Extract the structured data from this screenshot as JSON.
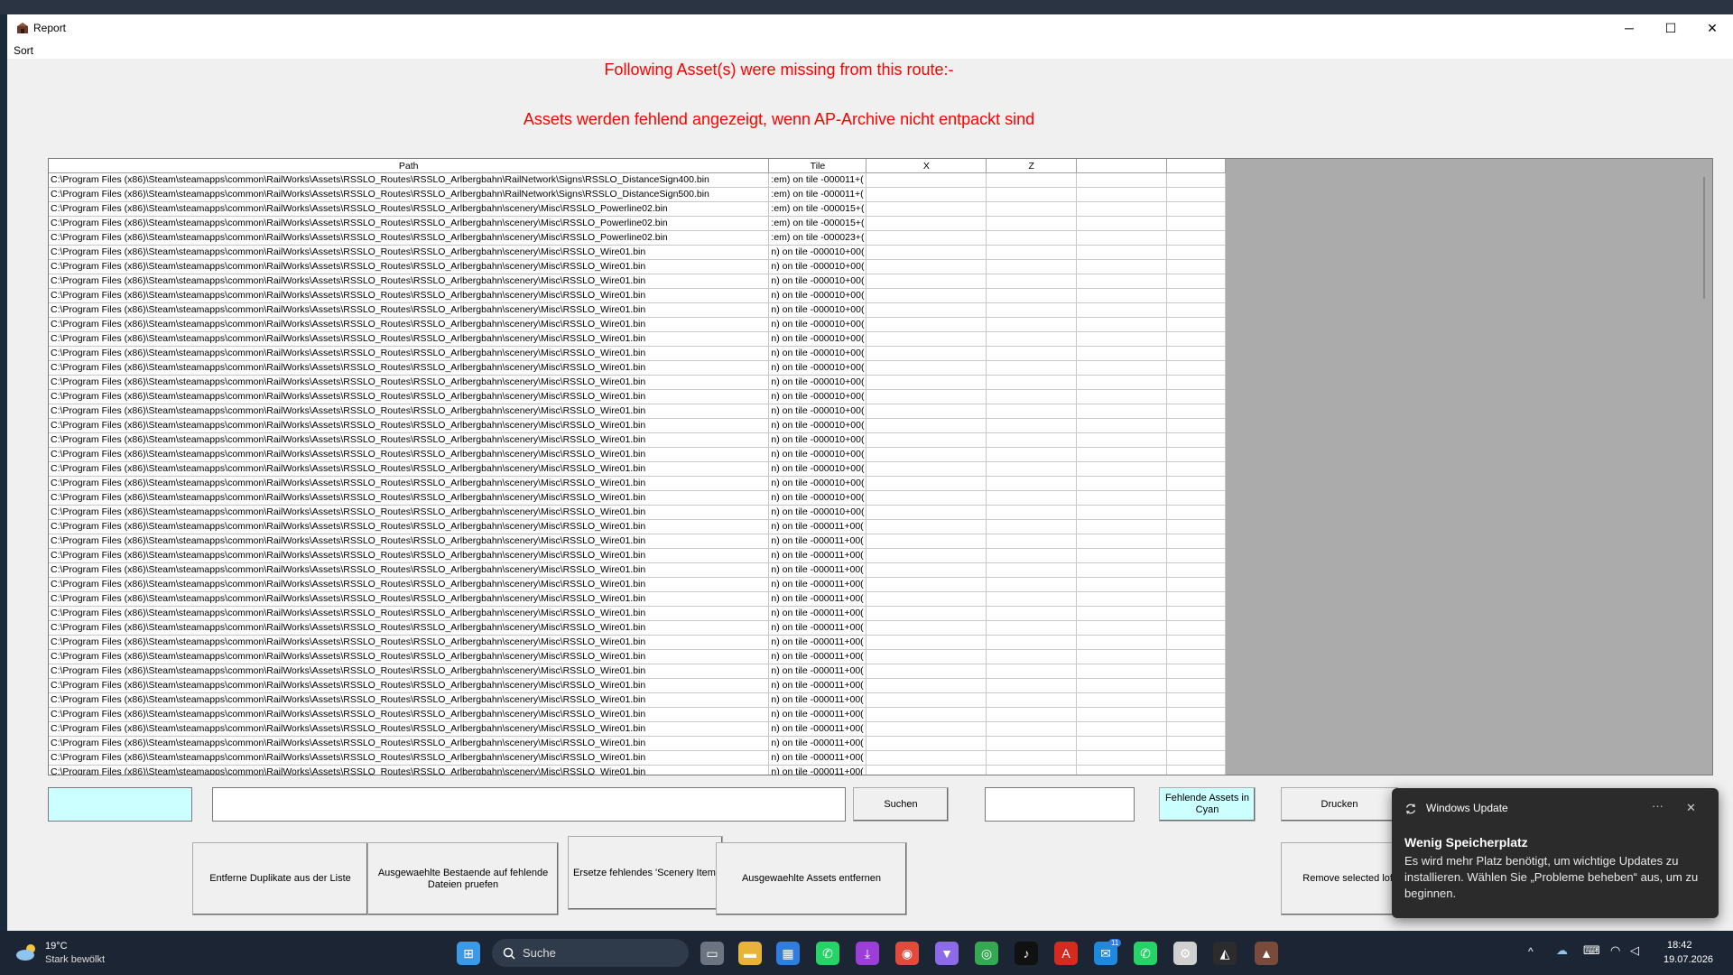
{
  "window": {
    "title": "Report",
    "minimize_glyph": "─",
    "maximize_glyph": "☐",
    "close_glyph": "✕"
  },
  "menu": {
    "sort": "Sort"
  },
  "messages": {
    "line1": "Following Asset(s) were missing from this route:-",
    "line2": "Assets werden fehlend angezeigt, wenn AP-Archive nicht entpackt sind"
  },
  "table": {
    "headers": [
      "Path",
      "Tile",
      "X",
      "Z",
      "",
      ""
    ],
    "rows": [
      [
        "C:\\Program Files (x86)\\Steam\\steamapps\\common\\RailWorks\\Assets\\RSSLO_Routes\\RSSLO_Arlbergbahn\\RailNetwork\\Signs\\RSSLO_DistanceSign400.bin",
        ":em) on tile -000011+(",
        "",
        "",
        "",
        ""
      ],
      [
        "C:\\Program Files (x86)\\Steam\\steamapps\\common\\RailWorks\\Assets\\RSSLO_Routes\\RSSLO_Arlbergbahn\\RailNetwork\\Signs\\RSSLO_DistanceSign500.bin",
        ":em) on tile -000011+(",
        "",
        "",
        "",
        ""
      ],
      [
        "C:\\Program Files (x86)\\Steam\\steamapps\\common\\RailWorks\\Assets\\RSSLO_Routes\\RSSLO_Arlbergbahn\\scenery\\Misc\\RSSLO_Powerline02.bin",
        ":em) on tile -000015+(",
        "",
        "",
        "",
        ""
      ],
      [
        "C:\\Program Files (x86)\\Steam\\steamapps\\common\\RailWorks\\Assets\\RSSLO_Routes\\RSSLO_Arlbergbahn\\scenery\\Misc\\RSSLO_Powerline02.bin",
        ":em) on tile -000015+(",
        "",
        "",
        "",
        ""
      ],
      [
        "C:\\Program Files (x86)\\Steam\\steamapps\\common\\RailWorks\\Assets\\RSSLO_Routes\\RSSLO_Arlbergbahn\\scenery\\Misc\\RSSLO_Powerline02.bin",
        ":em) on tile -000023+(",
        "",
        "",
        "",
        ""
      ],
      [
        "C:\\Program Files (x86)\\Steam\\steamapps\\common\\RailWorks\\Assets\\RSSLO_Routes\\RSSLO_Arlbergbahn\\scenery\\Misc\\RSSLO_Wire01.bin",
        "n) on tile -000010+00(",
        "",
        "",
        "",
        ""
      ],
      [
        "C:\\Program Files (x86)\\Steam\\steamapps\\common\\RailWorks\\Assets\\RSSLO_Routes\\RSSLO_Arlbergbahn\\scenery\\Misc\\RSSLO_Wire01.bin",
        "n) on tile -000010+00(",
        "",
        "",
        "",
        ""
      ],
      [
        "C:\\Program Files (x86)\\Steam\\steamapps\\common\\RailWorks\\Assets\\RSSLO_Routes\\RSSLO_Arlbergbahn\\scenery\\Misc\\RSSLO_Wire01.bin",
        "n) on tile -000010+00(",
        "",
        "",
        "",
        ""
      ],
      [
        "C:\\Program Files (x86)\\Steam\\steamapps\\common\\RailWorks\\Assets\\RSSLO_Routes\\RSSLO_Arlbergbahn\\scenery\\Misc\\RSSLO_Wire01.bin",
        "n) on tile -000010+00(",
        "",
        "",
        "",
        ""
      ],
      [
        "C:\\Program Files (x86)\\Steam\\steamapps\\common\\RailWorks\\Assets\\RSSLO_Routes\\RSSLO_Arlbergbahn\\scenery\\Misc\\RSSLO_Wire01.bin",
        "n) on tile -000010+00(",
        "",
        "",
        "",
        ""
      ],
      [
        "C:\\Program Files (x86)\\Steam\\steamapps\\common\\RailWorks\\Assets\\RSSLO_Routes\\RSSLO_Arlbergbahn\\scenery\\Misc\\RSSLO_Wire01.bin",
        "n) on tile -000010+00(",
        "",
        "",
        "",
        ""
      ],
      [
        "C:\\Program Files (x86)\\Steam\\steamapps\\common\\RailWorks\\Assets\\RSSLO_Routes\\RSSLO_Arlbergbahn\\scenery\\Misc\\RSSLO_Wire01.bin",
        "n) on tile -000010+00(",
        "",
        "",
        "",
        ""
      ],
      [
        "C:\\Program Files (x86)\\Steam\\steamapps\\common\\RailWorks\\Assets\\RSSLO_Routes\\RSSLO_Arlbergbahn\\scenery\\Misc\\RSSLO_Wire01.bin",
        "n) on tile -000010+00(",
        "",
        "",
        "",
        ""
      ],
      [
        "C:\\Program Files (x86)\\Steam\\steamapps\\common\\RailWorks\\Assets\\RSSLO_Routes\\RSSLO_Arlbergbahn\\scenery\\Misc\\RSSLO_Wire01.bin",
        "n) on tile -000010+00(",
        "",
        "",
        "",
        ""
      ],
      [
        "C:\\Program Files (x86)\\Steam\\steamapps\\common\\RailWorks\\Assets\\RSSLO_Routes\\RSSLO_Arlbergbahn\\scenery\\Misc\\RSSLO_Wire01.bin",
        "n) on tile -000010+00(",
        "",
        "",
        "",
        ""
      ],
      [
        "C:\\Program Files (x86)\\Steam\\steamapps\\common\\RailWorks\\Assets\\RSSLO_Routes\\RSSLO_Arlbergbahn\\scenery\\Misc\\RSSLO_Wire01.bin",
        "n) on tile -000010+00(",
        "",
        "",
        "",
        ""
      ],
      [
        "C:\\Program Files (x86)\\Steam\\steamapps\\common\\RailWorks\\Assets\\RSSLO_Routes\\RSSLO_Arlbergbahn\\scenery\\Misc\\RSSLO_Wire01.bin",
        "n) on tile -000010+00(",
        "",
        "",
        "",
        ""
      ],
      [
        "C:\\Program Files (x86)\\Steam\\steamapps\\common\\RailWorks\\Assets\\RSSLO_Routes\\RSSLO_Arlbergbahn\\scenery\\Misc\\RSSLO_Wire01.bin",
        "n) on tile -000010+00(",
        "",
        "",
        "",
        ""
      ],
      [
        "C:\\Program Files (x86)\\Steam\\steamapps\\common\\RailWorks\\Assets\\RSSLO_Routes\\RSSLO_Arlbergbahn\\scenery\\Misc\\RSSLO_Wire01.bin",
        "n) on tile -000010+00(",
        "",
        "",
        "",
        ""
      ],
      [
        "C:\\Program Files (x86)\\Steam\\steamapps\\common\\RailWorks\\Assets\\RSSLO_Routes\\RSSLO_Arlbergbahn\\scenery\\Misc\\RSSLO_Wire01.bin",
        "n) on tile -000010+00(",
        "",
        "",
        "",
        ""
      ],
      [
        "C:\\Program Files (x86)\\Steam\\steamapps\\common\\RailWorks\\Assets\\RSSLO_Routes\\RSSLO_Arlbergbahn\\scenery\\Misc\\RSSLO_Wire01.bin",
        "n) on tile -000010+00(",
        "",
        "",
        "",
        ""
      ],
      [
        "C:\\Program Files (x86)\\Steam\\steamapps\\common\\RailWorks\\Assets\\RSSLO_Routes\\RSSLO_Arlbergbahn\\scenery\\Misc\\RSSLO_Wire01.bin",
        "n) on tile -000010+00(",
        "",
        "",
        "",
        ""
      ],
      [
        "C:\\Program Files (x86)\\Steam\\steamapps\\common\\RailWorks\\Assets\\RSSLO_Routes\\RSSLO_Arlbergbahn\\scenery\\Misc\\RSSLO_Wire01.bin",
        "n) on tile -000010+00(",
        "",
        "",
        "",
        ""
      ],
      [
        "C:\\Program Files (x86)\\Steam\\steamapps\\common\\RailWorks\\Assets\\RSSLO_Routes\\RSSLO_Arlbergbahn\\scenery\\Misc\\RSSLO_Wire01.bin",
        "n) on tile -000010+00(",
        "",
        "",
        "",
        ""
      ],
      [
        "C:\\Program Files (x86)\\Steam\\steamapps\\common\\RailWorks\\Assets\\RSSLO_Routes\\RSSLO_Arlbergbahn\\scenery\\Misc\\RSSLO_Wire01.bin",
        "n) on tile -000011+00(",
        "",
        "",
        "",
        ""
      ],
      [
        "C:\\Program Files (x86)\\Steam\\steamapps\\common\\RailWorks\\Assets\\RSSLO_Routes\\RSSLO_Arlbergbahn\\scenery\\Misc\\RSSLO_Wire01.bin",
        "n) on tile -000011+00(",
        "",
        "",
        "",
        ""
      ],
      [
        "C:\\Program Files (x86)\\Steam\\steamapps\\common\\RailWorks\\Assets\\RSSLO_Routes\\RSSLO_Arlbergbahn\\scenery\\Misc\\RSSLO_Wire01.bin",
        "n) on tile -000011+00(",
        "",
        "",
        "",
        ""
      ],
      [
        "C:\\Program Files (x86)\\Steam\\steamapps\\common\\RailWorks\\Assets\\RSSLO_Routes\\RSSLO_Arlbergbahn\\scenery\\Misc\\RSSLO_Wire01.bin",
        "n) on tile -000011+00(",
        "",
        "",
        "",
        ""
      ],
      [
        "C:\\Program Files (x86)\\Steam\\steamapps\\common\\RailWorks\\Assets\\RSSLO_Routes\\RSSLO_Arlbergbahn\\scenery\\Misc\\RSSLO_Wire01.bin",
        "n) on tile -000011+00(",
        "",
        "",
        "",
        ""
      ],
      [
        "C:\\Program Files (x86)\\Steam\\steamapps\\common\\RailWorks\\Assets\\RSSLO_Routes\\RSSLO_Arlbergbahn\\scenery\\Misc\\RSSLO_Wire01.bin",
        "n) on tile -000011+00(",
        "",
        "",
        "",
        ""
      ],
      [
        "C:\\Program Files (x86)\\Steam\\steamapps\\common\\RailWorks\\Assets\\RSSLO_Routes\\RSSLO_Arlbergbahn\\scenery\\Misc\\RSSLO_Wire01.bin",
        "n) on tile -000011+00(",
        "",
        "",
        "",
        ""
      ],
      [
        "C:\\Program Files (x86)\\Steam\\steamapps\\common\\RailWorks\\Assets\\RSSLO_Routes\\RSSLO_Arlbergbahn\\scenery\\Misc\\RSSLO_Wire01.bin",
        "n) on tile -000011+00(",
        "",
        "",
        "",
        ""
      ],
      [
        "C:\\Program Files (x86)\\Steam\\steamapps\\common\\RailWorks\\Assets\\RSSLO_Routes\\RSSLO_Arlbergbahn\\scenery\\Misc\\RSSLO_Wire01.bin",
        "n) on tile -000011+00(",
        "",
        "",
        "",
        ""
      ],
      [
        "C:\\Program Files (x86)\\Steam\\steamapps\\common\\RailWorks\\Assets\\RSSLO_Routes\\RSSLO_Arlbergbahn\\scenery\\Misc\\RSSLO_Wire01.bin",
        "n) on tile -000011+00(",
        "",
        "",
        "",
        ""
      ],
      [
        "C:\\Program Files (x86)\\Steam\\steamapps\\common\\RailWorks\\Assets\\RSSLO_Routes\\RSSLO_Arlbergbahn\\scenery\\Misc\\RSSLO_Wire01.bin",
        "n) on tile -000011+00(",
        "",
        "",
        "",
        ""
      ],
      [
        "C:\\Program Files (x86)\\Steam\\steamapps\\common\\RailWorks\\Assets\\RSSLO_Routes\\RSSLO_Arlbergbahn\\scenery\\Misc\\RSSLO_Wire01.bin",
        "n) on tile -000011+00(",
        "",
        "",
        "",
        ""
      ],
      [
        "C:\\Program Files (x86)\\Steam\\steamapps\\common\\RailWorks\\Assets\\RSSLO_Routes\\RSSLO_Arlbergbahn\\scenery\\Misc\\RSSLO_Wire01.bin",
        "n) on tile -000011+00(",
        "",
        "",
        "",
        ""
      ],
      [
        "C:\\Program Files (x86)\\Steam\\steamapps\\common\\RailWorks\\Assets\\RSSLO_Routes\\RSSLO_Arlbergbahn\\scenery\\Misc\\RSSLO_Wire01.bin",
        "n) on tile -000011+00(",
        "",
        "",
        "",
        ""
      ],
      [
        "C:\\Program Files (x86)\\Steam\\steamapps\\common\\RailWorks\\Assets\\RSSLO_Routes\\RSSLO_Arlbergbahn\\scenery\\Misc\\RSSLO_Wire01.bin",
        "n) on tile -000011+00(",
        "",
        "",
        "",
        ""
      ],
      [
        "C:\\Program Files (x86)\\Steam\\steamapps\\common\\RailWorks\\Assets\\RSSLO_Routes\\RSSLO_Arlbergbahn\\scenery\\Misc\\RSSLO_Wire01.bin",
        "n) on tile -000011+00(",
        "",
        "",
        "",
        ""
      ],
      [
        "C:\\Program Files (x86)\\Steam\\steamapps\\common\\RailWorks\\Assets\\RSSLO_Routes\\RSSLO_Arlbergbahn\\scenery\\Misc\\RSSLO_Wire01.bin",
        "n) on tile -000011+00(",
        "",
        "",
        "",
        ""
      ],
      [
        "C:\\Program Files (x86)\\Steam\\steamapps\\common\\RailWorks\\Assets\\RSSLO_Routes\\RSSLO_Arlbergbahn\\scenery\\Misc\\RSSLO_Wire01.bin",
        "n) on tile -000011+00(",
        "",
        "",
        "",
        ""
      ],
      [
        "C:\\Program Files (x86)\\Steam\\steamapps\\common\\RailWorks\\Assets\\RSSLO_Routes\\RSSLO_Arlbergbahn\\scenery\\Misc\\RSSLO_Wire01.bin",
        "n) on tile -000011+00(",
        "",
        "",
        "",
        ""
      ]
    ]
  },
  "controls": {
    "search_value": "",
    "search_button": "Suchen",
    "right_input_value": "",
    "cyan_button": "Fehlende Assets in Cyan",
    "print_button": "Drucken",
    "remove_duplicates": "Entferne Duplikate aus der Liste",
    "check_selected": "Ausgewaehlte Bestaende auf fehlende Dateien pruefen",
    "replace_scenery": "Ersetze fehlendes 'Scenery Item'",
    "remove_selected_assets": "Ausgewaehlte Assets entfernen",
    "remove_selected_lofts": "Remove selected loft"
  },
  "toast": {
    "app": "Windows Update",
    "title": "Wenig Speicherplatz",
    "body": "Es wird mehr Platz benötigt, um wichtige Updates zu installieren. Wählen Sie „Probleme beheben“ aus, um zu beginnen.",
    "more_glyph": "···",
    "close_glyph": "✕"
  },
  "taskbar": {
    "weather_temp": "19°C",
    "weather_desc": "Stark bewölkt",
    "search_label": "Suche",
    "time": "18:42",
    "date": "19.07.2026",
    "badge_count": "11",
    "icons": [
      {
        "name": "windows-start-icon",
        "color": "#3b9ae8",
        "glyph": "⊞"
      },
      {
        "name": "task-view-icon",
        "color": "#6b7480",
        "glyph": "▭"
      },
      {
        "name": "file-explorer-icon",
        "color": "#e8b339",
        "glyph": "▬"
      },
      {
        "name": "microsoft-store-icon",
        "color": "#2f7de0",
        "glyph": "▦"
      },
      {
        "name": "whatsapp-icon",
        "color": "#25d366",
        "glyph": "✆"
      },
      {
        "name": "download-app-icon",
        "color": "#9b3fd8",
        "glyph": "⤓"
      },
      {
        "name": "chrome-icon",
        "color": "#e24a3b",
        "glyph": "◉"
      },
      {
        "name": "vpn-icon",
        "color": "#8c6ae8",
        "glyph": "▼"
      },
      {
        "name": "maps-icon",
        "color": "#34a853",
        "glyph": "◎"
      },
      {
        "name": "tiktok-icon",
        "color": "#111111",
        "glyph": "♪"
      },
      {
        "name": "acrobat-icon",
        "color": "#d42b1e",
        "glyph": "A"
      },
      {
        "name": "messaging-app-icon",
        "color": "#1d8ae0",
        "glyph": "✉"
      },
      {
        "name": "whatsapp-business-icon",
        "color": "#25d366",
        "glyph": "✆"
      },
      {
        "name": "tool-app-icon",
        "color": "#d0d0d0",
        "glyph": "⚙"
      },
      {
        "name": "arc-app-icon",
        "color": "#2c2c2c",
        "glyph": "◭"
      },
      {
        "name": "railworks-app-icon",
        "color": "#7a4b3a",
        "glyph": "▲"
      }
    ]
  },
  "colors": {
    "message_red": "#ff0000",
    "cyan": "#ccffff",
    "grid_gray": "#ababab"
  }
}
